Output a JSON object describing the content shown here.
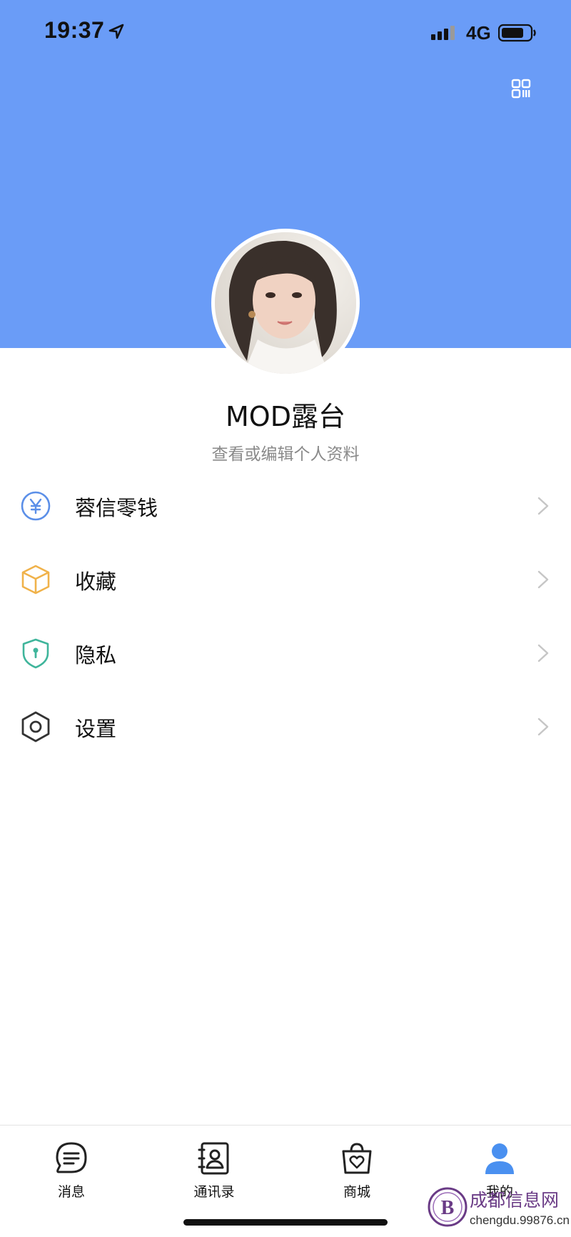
{
  "status_bar": {
    "time": "19:37",
    "network": "4G"
  },
  "header": {
    "background_color": "#6a9cf7",
    "qr_icon": "qr-code-icon"
  },
  "profile": {
    "name": "MOD露台",
    "subtitle": "查看或编辑个人资料",
    "avatar": "profile-photo"
  },
  "menu": {
    "items": [
      {
        "label": "蓉信零钱",
        "icon": "yen-coin-icon",
        "color": "#5b8fe8"
      },
      {
        "label": "收藏",
        "icon": "box-icon",
        "color": "#f0b24a"
      },
      {
        "label": "隐私",
        "icon": "shield-lock-icon",
        "color": "#3fb59b"
      },
      {
        "label": "设置",
        "icon": "hexagon-gear-icon",
        "color": "#333333"
      }
    ]
  },
  "tabbar": {
    "tabs": [
      {
        "label": "消息",
        "icon": "message-icon"
      },
      {
        "label": "通讯录",
        "icon": "contacts-icon"
      },
      {
        "label": "商城",
        "icon": "shopping-bag-icon"
      },
      {
        "label": "我的",
        "icon": "person-icon",
        "active": true,
        "active_color": "#4a90f0"
      }
    ]
  },
  "watermark": {
    "title": "成都信息网",
    "url": "chengdu.99876.cn",
    "logo_letter": "B"
  }
}
